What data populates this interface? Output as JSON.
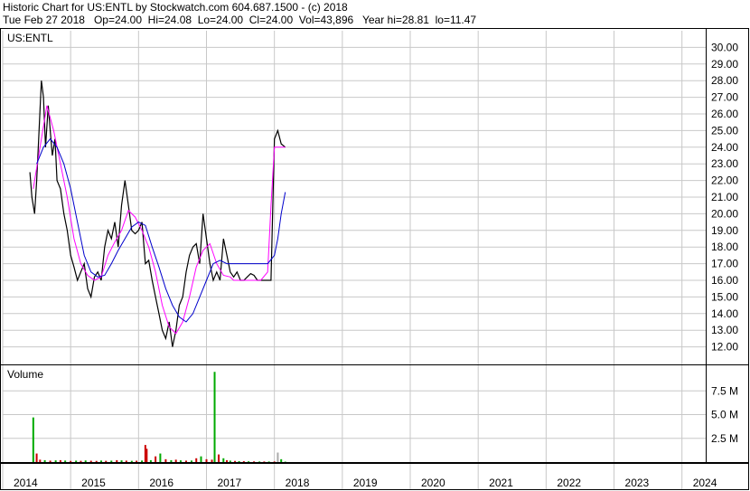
{
  "header": {
    "line1": "Historic Chart for US:ENTL by Stockwatch.com 604.687.1500 - (c) 2018",
    "line2": "Tue Feb 27 2018   Op=24.00  Hi=24.08  Lo=24.00  Cl=24.00  Vol=43,896   Year hi=28.81  lo=11.47"
  },
  "chart_data": {
    "type": "line",
    "symbol": "US:ENTL",
    "price_axis": {
      "ylim": [
        11,
        31
      ],
      "ticks": [
        12,
        13,
        14,
        15,
        16,
        17,
        18,
        19,
        20,
        21,
        22,
        23,
        24,
        25,
        26,
        27,
        28,
        29,
        30
      ],
      "tick_labels": [
        "12.00",
        "13.00",
        "14.00",
        "15.00",
        "16.00",
        "17.00",
        "18.00",
        "19.00",
        "20.00",
        "21.00",
        "22.00",
        "23.00",
        "24.00",
        "25.00",
        "26.00",
        "27.00",
        "28.00",
        "29.00",
        "30.00"
      ]
    },
    "volume_axis": {
      "label": "Volume",
      "ylim": [
        0,
        10000000
      ],
      "ticks": [
        2500000,
        5000000,
        7500000
      ],
      "tick_labels": [
        "2.5 M",
        "5.0 M",
        "7.5 M"
      ]
    },
    "x_axis": {
      "labels": [
        "2014",
        "2015",
        "2016",
        "2017",
        "2018",
        "2019",
        "2020",
        "2021",
        "2022",
        "2023",
        "2024"
      ],
      "xlim": [
        2014.0,
        2024.35
      ]
    },
    "grid": true,
    "series": [
      {
        "role": "price",
        "color": "#000000",
        "x": [
          2014.4,
          2014.43,
          2014.47,
          2014.5,
          2014.53,
          2014.57,
          2014.6,
          2014.63,
          2014.67,
          2014.7,
          2014.73,
          2014.77,
          2014.8,
          2014.85,
          2014.9,
          2014.95,
          2015.0,
          2015.05,
          2015.1,
          2015.15,
          2015.2,
          2015.25,
          2015.3,
          2015.35,
          2015.4,
          2015.45,
          2015.5,
          2015.55,
          2015.6,
          2015.65,
          2015.7,
          2015.75,
          2015.8,
          2015.85,
          2015.9,
          2015.95,
          2016.0,
          2016.05,
          2016.1,
          2016.15,
          2016.2,
          2016.25,
          2016.3,
          2016.35,
          2016.4,
          2016.45,
          2016.5,
          2016.55,
          2016.6,
          2016.65,
          2016.7,
          2016.75,
          2016.8,
          2016.85,
          2016.9,
          2016.95,
          2017.0,
          2017.05,
          2017.1,
          2017.15,
          2017.2,
          2017.25,
          2017.3,
          2017.35,
          2017.4,
          2017.45,
          2017.5,
          2017.55,
          2017.6,
          2017.65,
          2017.7,
          2017.75,
          2017.8,
          2017.85,
          2017.9,
          2017.95,
          2018.0,
          2018.05,
          2018.1,
          2018.16
        ],
        "y": [
          22.5,
          21.0,
          20.0,
          22.0,
          24.5,
          28.0,
          27.0,
          24.0,
          26.5,
          25.0,
          23.5,
          24.5,
          22.0,
          21.5,
          20.0,
          19.0,
          17.5,
          16.8,
          16.0,
          16.5,
          17.0,
          15.5,
          15.0,
          16.2,
          16.5,
          16.0,
          18.0,
          19.0,
          18.5,
          19.5,
          18.0,
          20.5,
          22.0,
          20.5,
          19.0,
          18.8,
          19.0,
          19.5,
          17.0,
          17.2,
          16.0,
          15.0,
          14.0,
          13.0,
          12.5,
          13.5,
          12.0,
          13.0,
          14.5,
          15.0,
          16.5,
          17.5,
          18.0,
          18.2,
          17.0,
          20.0,
          18.5,
          17.0,
          16.0,
          16.5,
          16.0,
          18.5,
          17.5,
          16.5,
          16.2,
          16.5,
          16.0,
          16.0,
          16.2,
          16.4,
          16.3,
          16.0,
          16.0,
          16.0,
          16.0,
          16.0,
          24.5,
          25.0,
          24.2,
          24.0
        ]
      },
      {
        "role": "moving-average-short",
        "color": "#ff00ff",
        "x": [
          2014.45,
          2014.55,
          2014.65,
          2014.75,
          2014.85,
          2014.95,
          2015.05,
          2015.15,
          2015.25,
          2015.35,
          2015.45,
          2015.55,
          2015.65,
          2015.75,
          2015.85,
          2015.95,
          2016.05,
          2016.15,
          2016.25,
          2016.35,
          2016.45,
          2016.55,
          2016.65,
          2016.75,
          2016.85,
          2016.95,
          2017.05,
          2017.15,
          2017.25,
          2017.35,
          2017.4,
          2017.5,
          2017.6,
          2017.7,
          2017.8,
          2017.9,
          2017.95,
          2018.0,
          2018.05,
          2018.1,
          2018.16
        ],
        "y": [
          21.5,
          24.0,
          26.5,
          25.0,
          23.0,
          21.0,
          18.5,
          17.0,
          16.3,
          16.0,
          16.2,
          17.5,
          18.3,
          19.0,
          20.2,
          19.8,
          19.0,
          18.0,
          16.5,
          14.5,
          13.2,
          12.8,
          13.5,
          15.0,
          16.8,
          17.8,
          18.2,
          17.0,
          16.3,
          16.2,
          16.0,
          16.0,
          16.0,
          16.0,
          16.0,
          16.5,
          20.5,
          24.0,
          24.0,
          24.0,
          24.0
        ]
      },
      {
        "role": "moving-average-long",
        "color": "#0000cc",
        "x": [
          2014.5,
          2014.6,
          2014.7,
          2014.8,
          2014.9,
          2015.0,
          2015.1,
          2015.2,
          2015.3,
          2015.4,
          2015.5,
          2015.6,
          2015.7,
          2015.8,
          2015.9,
          2016.0,
          2016.1,
          2016.2,
          2016.3,
          2016.4,
          2016.5,
          2016.6,
          2016.7,
          2016.8,
          2016.9,
          2017.0,
          2017.1,
          2017.2,
          2017.3,
          2017.35,
          2017.4,
          2017.5,
          2017.6,
          2017.7,
          2017.8,
          2017.9,
          2018.0,
          2018.05,
          2018.1,
          2018.16
        ],
        "y": [
          23.0,
          24.0,
          24.5,
          24.0,
          23.0,
          21.5,
          19.5,
          17.5,
          16.5,
          16.2,
          16.3,
          17.0,
          17.8,
          18.5,
          19.2,
          19.5,
          19.3,
          18.0,
          16.8,
          15.5,
          14.5,
          13.8,
          13.5,
          14.0,
          15.0,
          16.0,
          17.0,
          17.2,
          17.0,
          17.0,
          17.0,
          17.0,
          17.0,
          17.0,
          17.0,
          17.0,
          17.5,
          18.5,
          20.0,
          21.3
        ]
      }
    ],
    "volume": {
      "x": [
        2014.45,
        2014.5,
        2014.55,
        2014.62,
        2014.7,
        2014.78,
        2014.85,
        2014.92,
        2015.0,
        2015.08,
        2015.15,
        2015.22,
        2015.3,
        2015.38,
        2015.45,
        2015.52,
        2015.6,
        2015.68,
        2015.75,
        2015.82,
        2015.9,
        2015.97,
        2016.05,
        2016.1,
        2016.12,
        2016.18,
        2016.25,
        2016.32,
        2016.4,
        2016.48,
        2016.55,
        2016.62,
        2016.7,
        2016.78,
        2016.85,
        2016.92,
        2017.0,
        2017.08,
        2017.12,
        2017.18,
        2017.25,
        2017.3,
        2017.35,
        2017.42,
        2017.48,
        2017.55,
        2017.62,
        2017.7,
        2017.78,
        2017.85,
        2017.92,
        2018.0,
        2018.05,
        2018.1,
        2018.16
      ],
      "values": [
        4700000,
        900000,
        250000,
        200000,
        150000,
        180000,
        200000,
        160000,
        120000,
        150000,
        130000,
        170000,
        140000,
        120000,
        160000,
        130000,
        150000,
        200000,
        180000,
        150000,
        130000,
        140000,
        160000,
        1800000,
        1400000,
        200000,
        600000,
        900000,
        300000,
        200000,
        250000,
        180000,
        150000,
        160000,
        400000,
        600000,
        300000,
        250000,
        9500000,
        800000,
        400000,
        200000,
        150000,
        120000,
        100000,
        90000,
        80000,
        70000,
        60000,
        60000,
        60000,
        60000,
        1000000,
        300000,
        43896
      ],
      "colors": [
        "#00aa00",
        "#cc0000",
        "#cc0000",
        "#00aa00",
        "#cc0000",
        "#00aa00",
        "#cc0000",
        "#00aa00",
        "#cc0000",
        "#00aa00",
        "#cc0000",
        "#00aa00",
        "#cc0000",
        "#cc0000",
        "#00aa00",
        "#cc0000",
        "#00aa00",
        "#cc0000",
        "#00aa00",
        "#cc0000",
        "#00aa00",
        "#cc0000",
        "#00aa00",
        "#cc0000",
        "#cc0000",
        "#00aa00",
        "#cc0000",
        "#00aa00",
        "#cc0000",
        "#00aa00",
        "#cc0000",
        "#00aa00",
        "#cc0000",
        "#00aa00",
        "#cc0000",
        "#00aa00",
        "#cc0000",
        "#cc0000",
        "#00aa00",
        "#cc0000",
        "#00aa00",
        "#cc0000",
        "#00aa00",
        "#cc0000",
        "#00aa00",
        "#cc0000",
        "#00aa00",
        "#cc0000",
        "#00aa00",
        "#cc0000",
        "#00aa00",
        "#cc0000",
        "#aaaaaa",
        "#00aa00",
        "#00aa00"
      ]
    }
  }
}
